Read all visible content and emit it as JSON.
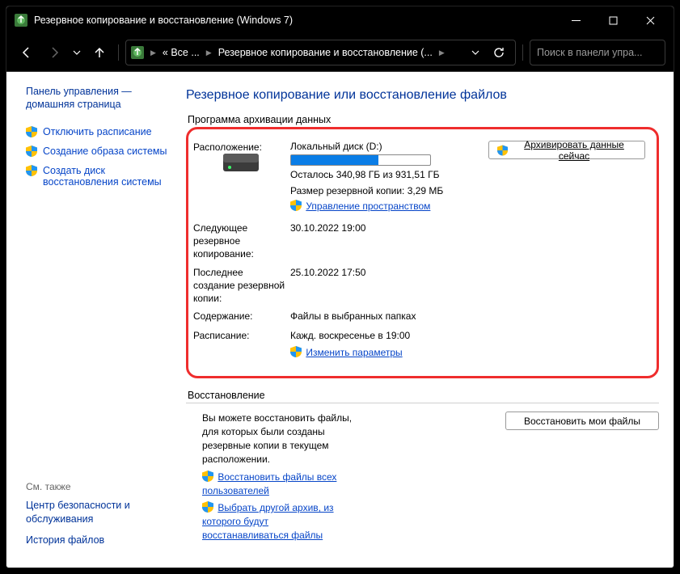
{
  "titlebar": {
    "title": "Резервное копирование и восстановление (Windows 7)"
  },
  "breadcrumb": {
    "item1": "« Все ...",
    "item2": "Резервное копирование и восстановление (..."
  },
  "search": {
    "placeholder": "Поиск в панели упра..."
  },
  "sidebar": {
    "home": "Панель управления — домашняя страница",
    "item1": "Отключить расписание",
    "item2": "Создание образа системы",
    "item3": "Создать диск восстановления системы",
    "seealso": "См. также",
    "bottom1": "Центр безопасности и обслуживания",
    "bottom2": "История файлов"
  },
  "main": {
    "page_title": "Резервное копирование или восстановление файлов",
    "section_backup": "Программа архивации данных",
    "section_restore": "Восстановление",
    "archive_now": "Архивировать данные сейчас",
    "restore_files": "Восстановить мои файлы",
    "restore_text": "Вы можете восстановить файлы, для которых были созданы резервные копии в текущем расположении.",
    "restore_link1": "Восстановить файлы всех пользователей",
    "restore_link2": "Выбрать другой архив, из которого будут восстанавливаться файлы"
  },
  "backup": {
    "label_location": "Расположение:",
    "location_name": "Локальный диск (D:)",
    "space_remaining": "Осталось 340,98 ГБ из 931,51 ГБ",
    "backup_size": "Размер резервной копии: 3,29 МБ",
    "manage_space": "Управление пространством",
    "label_next": "Следующее резервное копирование:",
    "next": "30.10.2022 19:00",
    "label_last": "Последнее создание резервной копии:",
    "last": "25.10.2022 17:50",
    "label_content": "Содержание:",
    "content": "Файлы в выбранных папках",
    "label_schedule": "Расписание:",
    "schedule": "Кажд. воскресенье в 19:00",
    "change_params": "Изменить параметры"
  }
}
